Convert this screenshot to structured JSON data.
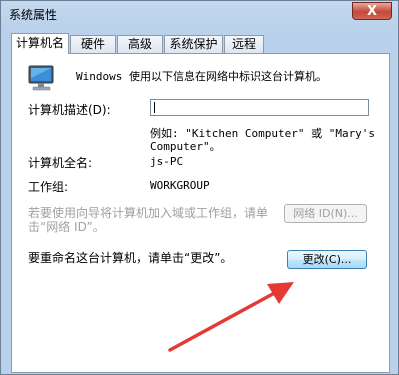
{
  "window": {
    "title": "系统属性",
    "close_label": "X"
  },
  "tabs": [
    {
      "label": "计算机名",
      "active": true
    },
    {
      "label": "硬件",
      "active": false
    },
    {
      "label": "高级",
      "active": false
    },
    {
      "label": "系统保护",
      "active": false
    },
    {
      "label": "远程",
      "active": false
    }
  ],
  "info": {
    "text": "Windows 使用以下信息在网络中标识这台计算机。"
  },
  "description": {
    "label": "计算机描述(D):",
    "value": "",
    "example_line1": "例如: \"Kitchen Computer\" 或 \"Mary's",
    "example_line2": "Computer\"。"
  },
  "full_name": {
    "label": "计算机全名:",
    "value": "js-PC"
  },
  "workgroup": {
    "label": "工作组:",
    "value": "WORKGROUP"
  },
  "network_id": {
    "text_line1": "若要使用向导将计算机加入域或工作组，请单",
    "text_line2": "击“网络 ID”。",
    "button_label": "网络 ID(N)..."
  },
  "rename": {
    "text": "要重命名这台计算机，请单击“更改”。",
    "button_label": "更改(C)..."
  },
  "colors": {
    "arrow": "#e53935",
    "window_frame": "#b9d1ea",
    "close_button": "#c4483a"
  },
  "icons": {
    "computer": "computer-monitor-icon"
  }
}
